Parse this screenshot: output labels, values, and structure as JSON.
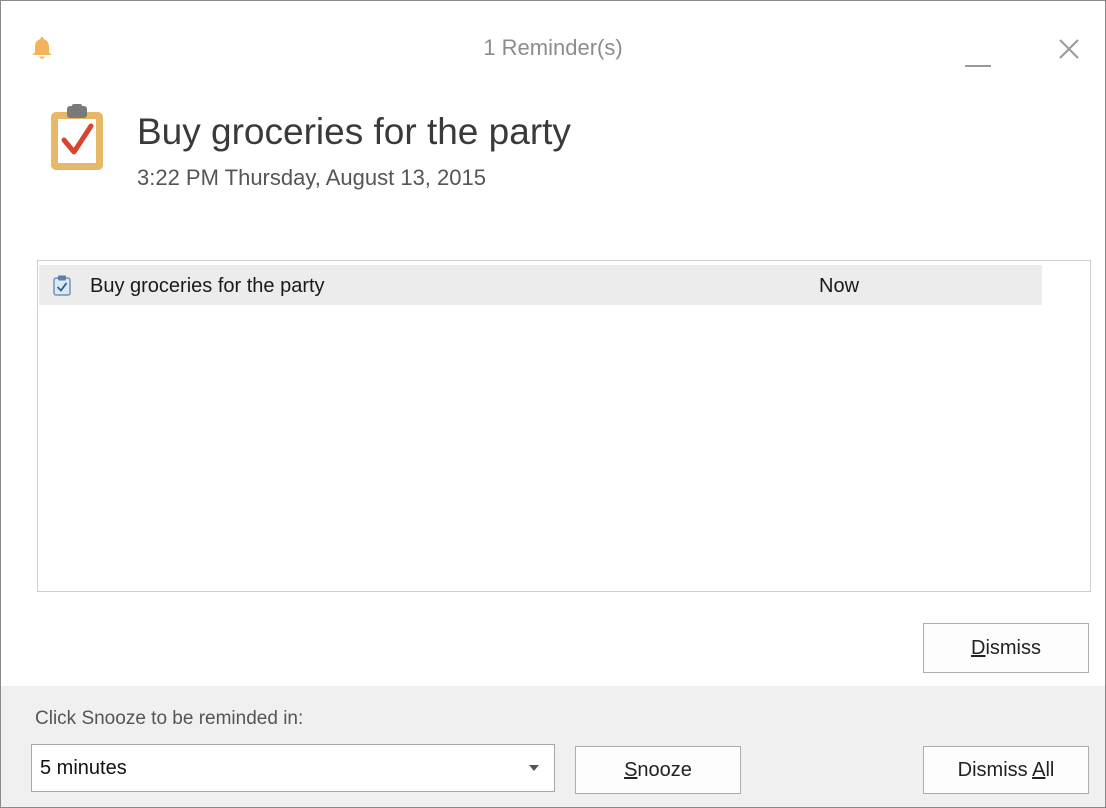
{
  "window": {
    "title": "1 Reminder(s)",
    "icon": "bell-icon",
    "controls": {
      "minimize_icon": "minimize-icon",
      "close_icon": "close-icon"
    }
  },
  "header": {
    "icon": "task-clipboard-icon",
    "subject": "Buy groceries for the party",
    "due_time": "3:22 PM Thursday, August 13, 2015"
  },
  "reminders": [
    {
      "icon": "task-icon",
      "subject": "Buy groceries for the party",
      "due_in": "Now"
    }
  ],
  "buttons": {
    "dismiss": {
      "mnemonic": "D",
      "rest": "ismiss"
    },
    "snooze": {
      "mnemonic": "S",
      "rest": "nooze"
    },
    "dismiss_all": {
      "prefix": "Dismiss ",
      "mnemonic": "A",
      "rest": "ll"
    }
  },
  "snooze": {
    "label": "Click Snooze to be reminded in:",
    "selected": "5 minutes"
  },
  "colors": {
    "bell": "#F3B35A",
    "task_icon_frame": "#E7B865",
    "checkmark": "#D9452C",
    "selected_row": "#ECECEC",
    "bottom_panel": "#F0F0F0"
  }
}
